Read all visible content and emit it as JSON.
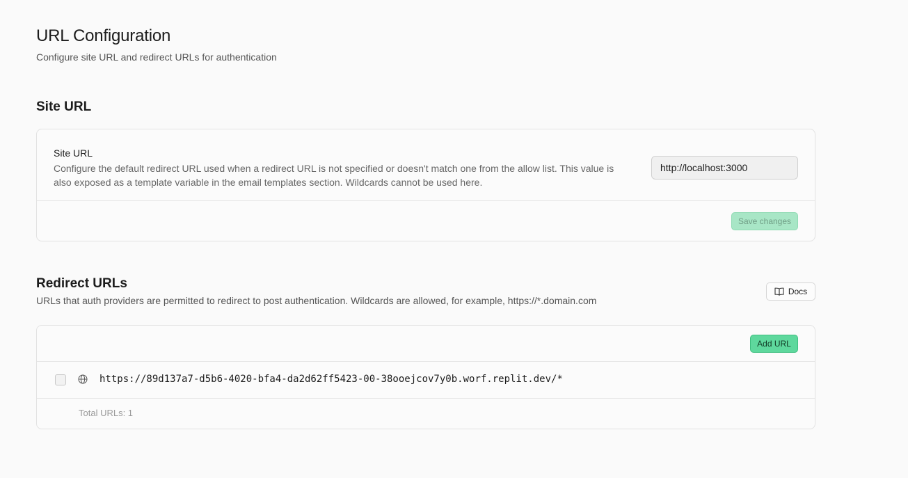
{
  "header": {
    "title": "URL Configuration",
    "subtitle": "Configure site URL and redirect URLs for authentication"
  },
  "site_url": {
    "section_title": "Site URL",
    "field_label": "Site URL",
    "field_description": "Configure the default redirect URL used when a redirect URL is not specified or doesn't match one from the allow list. This value is also exposed as a template variable in the email templates section. Wildcards cannot be used here.",
    "input_value": "http://localhost:3000",
    "save_label": "Save changes"
  },
  "redirect_urls": {
    "section_title": "Redirect URLs",
    "description": "URLs that auth providers are permitted to redirect to post authentication. Wildcards are allowed, for example, https://*.domain.com",
    "docs_label": "Docs",
    "docs_icon": "book-open-icon",
    "add_label": "Add URL",
    "rows": [
      {
        "url": "https://89d137a7-d5b6-4020-bfa4-da2d62ff5423-00-38ooejcov7y0b.worf.replit.dev/*",
        "icon": "globe-icon",
        "checked": false
      }
    ],
    "total_text": "Total URLs: 1"
  },
  "colors": {
    "accent": "#5ed89d",
    "accent_disabled": "#a8e6c6",
    "background": "#fafafa",
    "border": "#e2e2e2"
  }
}
